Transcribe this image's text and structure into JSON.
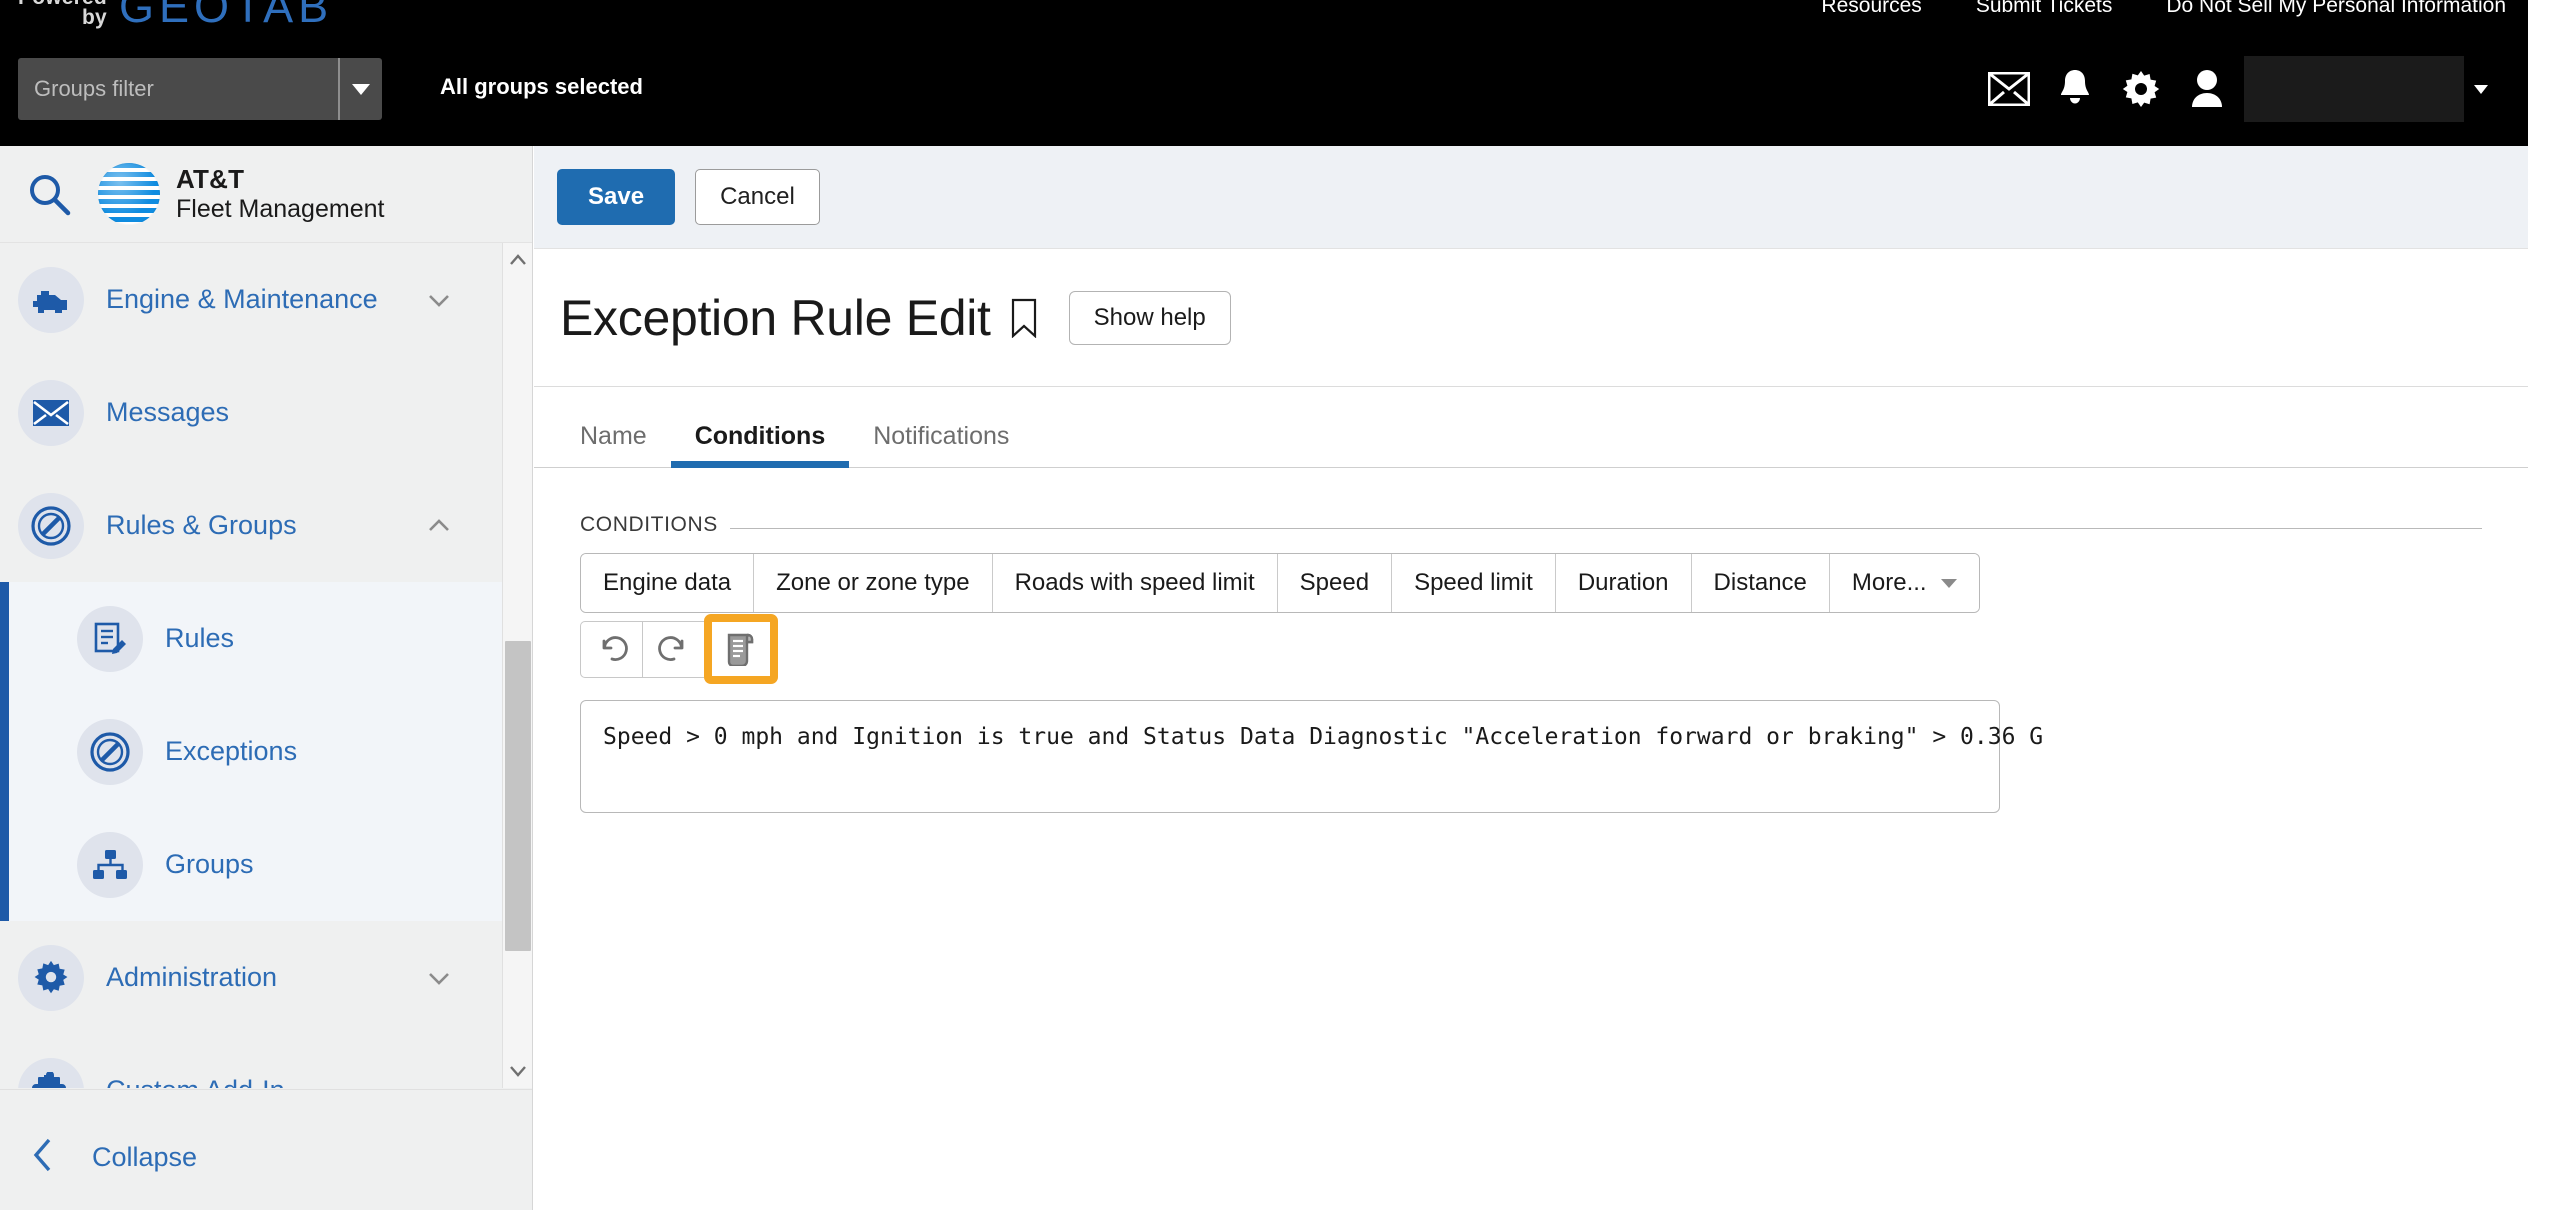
{
  "topbar": {
    "powered_line1": "Powered",
    "powered_line2": "by",
    "logo": "GEOTAB",
    "links": [
      {
        "label": "Resources"
      },
      {
        "label": "Submit Tickets"
      },
      {
        "label": "Do Not Sell My Personal Information"
      }
    ],
    "groups_filter_placeholder": "Groups filter",
    "groups_filter_value": "",
    "all_groups_selected": "All groups selected",
    "icons": [
      {
        "name": "mail-icon"
      },
      {
        "name": "bell-icon"
      },
      {
        "name": "gear-icon"
      },
      {
        "name": "user-icon"
      }
    ],
    "user_name": ""
  },
  "sidebar": {
    "search_icon": "search-icon",
    "brand_line1": "AT&T",
    "brand_line2": "Fleet Management",
    "items": [
      {
        "label": "Engine & Maintenance",
        "icon": "engine-icon",
        "chevron": "down",
        "sub": false
      },
      {
        "label": "Messages",
        "icon": "mail-icon",
        "chevron": "",
        "sub": false
      },
      {
        "label": "Rules & Groups",
        "icon": "prohibited-icon",
        "chevron": "up",
        "sub": false
      },
      {
        "label": "Rules",
        "icon": "rules-edit-icon",
        "chevron": "",
        "sub": true
      },
      {
        "label": "Exceptions",
        "icon": "prohibited-icon",
        "chevron": "",
        "sub": true
      },
      {
        "label": "Groups",
        "icon": "org-tree-icon",
        "chevron": "",
        "sub": true
      },
      {
        "label": "Administration",
        "icon": "gear-icon",
        "chevron": "down",
        "sub": false
      },
      {
        "label": "Custom Add-In",
        "icon": "puzzle-icon",
        "chevron": "",
        "sub": false
      }
    ],
    "collapse_label": "Collapse"
  },
  "main": {
    "save_label": "Save",
    "cancel_label": "Cancel",
    "page_title": "Exception Rule Edit",
    "show_help_label": "Show help",
    "tabs": [
      {
        "label": "Name",
        "active": false
      },
      {
        "label": "Conditions",
        "active": true
      },
      {
        "label": "Notifications",
        "active": false
      }
    ],
    "conditions": {
      "legend": "CONDITIONS",
      "buttons": [
        {
          "label": "Engine data"
        },
        {
          "label": "Zone or zone type"
        },
        {
          "label": "Roads with speed limit"
        },
        {
          "label": "Speed"
        },
        {
          "label": "Speed limit"
        },
        {
          "label": "Duration"
        },
        {
          "label": "Distance"
        },
        {
          "label": "More..."
        }
      ],
      "tools": [
        {
          "name": "undo-icon"
        },
        {
          "name": "redo-icon"
        },
        {
          "name": "script-icon",
          "highlighted": true
        }
      ],
      "expression": "Speed > 0 mph and Ignition is true and Status Data Diagnostic \"Acceleration forward or braking\" > 0.36 G"
    }
  },
  "colors": {
    "accent_blue": "#1f6cb0",
    "link_blue": "#2d6cb5",
    "highlight_orange": "#f5a623",
    "topbar_black": "#000000",
    "sidebar_bg": "#eff0f0"
  }
}
